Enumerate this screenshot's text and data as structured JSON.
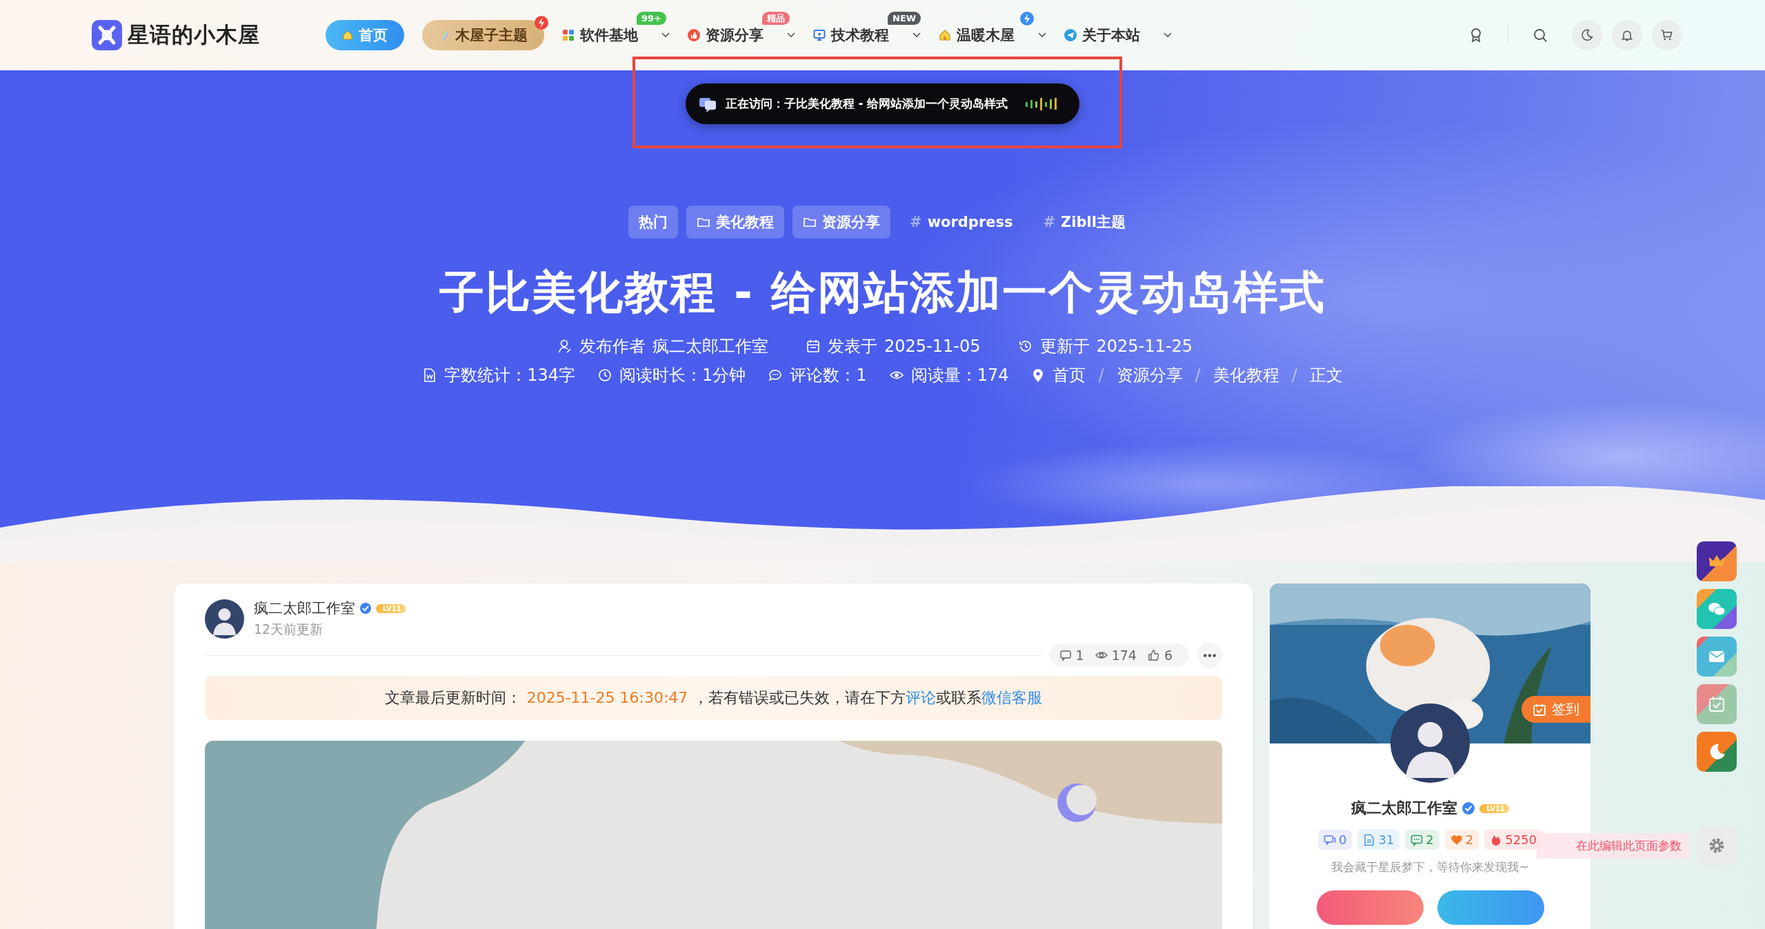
{
  "logo": {
    "text": "星语的小木屋"
  },
  "nav": [
    {
      "label": "首页",
      "kind": "primary"
    },
    {
      "label": "木屋子主题",
      "kind": "featured",
      "flash": true,
      "color": "#f0443c"
    },
    {
      "label": "软件基地",
      "kind": "link",
      "badge": "99+",
      "color": "#45c24e",
      "dropdown": true
    },
    {
      "label": "资源分享",
      "kind": "link",
      "badge": "精品",
      "color": "#f2707a",
      "dropdown": true
    },
    {
      "label": "技术教程",
      "kind": "link",
      "badge": "NEW",
      "color": "#555a60",
      "dropdown": true
    },
    {
      "label": "温暖木屋",
      "kind": "link",
      "flash": true,
      "color": "#3b8ff0",
      "dropdown": true
    },
    {
      "label": "关于本站",
      "kind": "link",
      "dropdown": true
    }
  ],
  "island": {
    "text": "正在访问：子比美化教程 - 给网站添加一个灵动岛样式"
  },
  "hero": {
    "tags": [
      {
        "label": "热门",
        "kind": "badge"
      },
      {
        "label": "美化教程",
        "kind": "category"
      },
      {
        "label": "资源分享",
        "kind": "category"
      },
      {
        "label": "wordpress",
        "kind": "tag",
        "prefix": "#"
      },
      {
        "label": "Zibll主题",
        "kind": "tag",
        "prefix": "#"
      }
    ],
    "title": "子比美化教程 - 给网站添加一个灵动岛样式",
    "meta": [
      {
        "label": "发布作者",
        "value": "疯二太郎工作室"
      },
      {
        "label": "发表于",
        "value": "2025-11-05"
      },
      {
        "label": "更新于",
        "value": "2025-11-25"
      }
    ],
    "stats": [
      "字数统计：134字",
      "阅读时长：1分钟",
      "评论数：1",
      "阅读量：174"
    ],
    "breadcrumb": {
      "separator": "/",
      "items": [
        "首页",
        "资源分享",
        "美化教程",
        "正文"
      ]
    }
  },
  "article": {
    "author": "疯二太郎工作室",
    "level": "LV11",
    "time": "12天前更新",
    "counts": [
      "1",
      "174",
      "6"
    ],
    "notice": [
      {
        "kind": "text",
        "text": "文章最后更新时间："
      },
      {
        "kind": "date",
        "text": "2025-11-25 16:30:47"
      },
      {
        "kind": "text",
        "text": "，若有错误或已失效，请在下方"
      },
      {
        "kind": "link",
        "text": "评论"
      },
      {
        "kind": "text",
        "text": "或联系"
      },
      {
        "kind": "link",
        "text": "微信客服"
      }
    ],
    "cover": {
      "kind": "picture"
    }
  },
  "profile": {
    "signin": "签到",
    "name": "疯二太郎工作室",
    "level": "LV11",
    "stats": [
      {
        "value": "0",
        "color": "#5b7be8"
      },
      {
        "value": "31",
        "color": "#4a9be0"
      },
      {
        "value": "2",
        "color": "#2e9e58"
      },
      {
        "value": "2",
        "color": "#f07a28"
      },
      {
        "value": "5250",
        "color": "#f04848"
      }
    ],
    "bio": "我会藏于星辰梦下，等待你来发现我~"
  },
  "edit_tip": "在此编辑此页面参数"
}
